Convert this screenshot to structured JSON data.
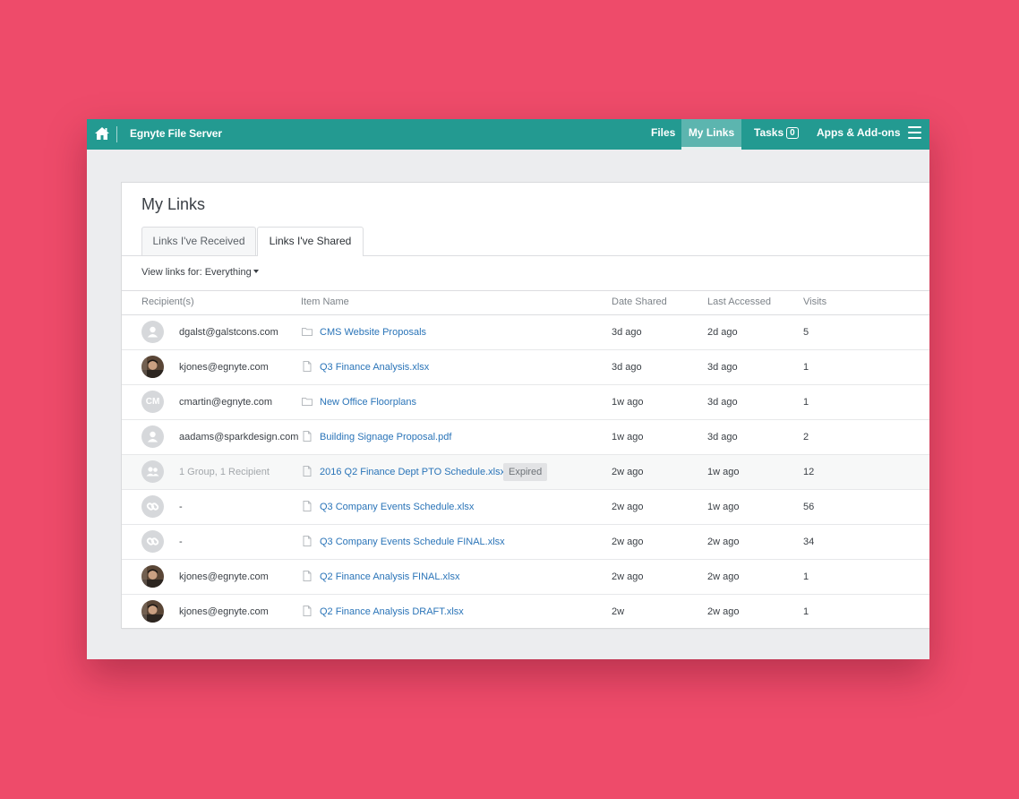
{
  "nav": {
    "brand": "Egnyte File Server",
    "files": "Files",
    "my_links": "My Links",
    "tasks": "Tasks",
    "tasks_count": "0",
    "apps": "Apps & Add-ons"
  },
  "page": {
    "title": "My Links",
    "tabs": [
      "Links I've Received",
      "Links I've Shared"
    ],
    "active_tab": "Links I've Shared",
    "filter_label": "View links for: Everything"
  },
  "table": {
    "headers": [
      "Recipient(s)",
      "Item Name",
      "Date Shared",
      "Last Accessed",
      "Visits"
    ],
    "rows": [
      {
        "avatar": "person-icon",
        "recipient": "dgalst@galstcons.com",
        "item_icon": "folder-icon",
        "item": "CMS Website Proposals",
        "date_shared": "3d ago",
        "last_accessed": "2d ago",
        "visits": "5"
      },
      {
        "avatar": "user-photo",
        "recipient": "kjones@egnyte.com",
        "item_icon": "file-icon",
        "item": "Q3 Finance Analysis.xlsx",
        "date_shared": "3d ago",
        "last_accessed": "3d ago",
        "visits": "1"
      },
      {
        "avatar": "CM",
        "recipient": "cmartin@egnyte.com",
        "item_icon": "folder-icon",
        "item": "New Office Floorplans",
        "date_shared": "1w ago",
        "last_accessed": "3d ago",
        "visits": "1"
      },
      {
        "avatar": "person-icon",
        "recipient": "aadams@sparkdesign.com",
        "item_icon": "file-icon",
        "item": "Building Signage Proposal.pdf",
        "date_shared": "1w ago",
        "last_accessed": "3d ago",
        "visits": "2"
      },
      {
        "avatar": "group-icon",
        "recipient": "1 Group, 1 Recipient",
        "item_icon": "file-icon",
        "item": "2016 Q2 Finance Dept PTO Schedule.xlsx",
        "badge": "Expired",
        "date_shared": "2w ago",
        "last_accessed": "1w ago",
        "visits": "12"
      },
      {
        "avatar": "link-icon",
        "recipient": "-",
        "item_icon": "file-icon",
        "item": "Q3 Company Events Schedule.xlsx",
        "date_shared": "2w ago",
        "last_accessed": "1w ago",
        "visits": "56"
      },
      {
        "avatar": "link-icon",
        "recipient": "-",
        "item_icon": "file-icon",
        "item": "Q3 Company Events Schedule FINAL.xlsx",
        "date_shared": "2w ago",
        "last_accessed": "2w ago",
        "visits": "34"
      },
      {
        "avatar": "user-photo",
        "recipient": "kjones@egnyte.com",
        "item_icon": "file-icon",
        "item": "Q2 Finance Analysis FINAL.xlsx",
        "date_shared": "2w ago",
        "last_accessed": "2w ago",
        "visits": "1"
      },
      {
        "avatar": "user-photo",
        "recipient": "kjones@egnyte.com",
        "item_icon": "file-icon",
        "item": "Q2 Finance Analysis DRAFT.xlsx",
        "date_shared": "2w",
        "last_accessed": "2w ago",
        "visits": "1"
      }
    ]
  },
  "colors": {
    "background": "#ee4b6a",
    "navbar": "#239a91",
    "link": "#2a74b8"
  }
}
